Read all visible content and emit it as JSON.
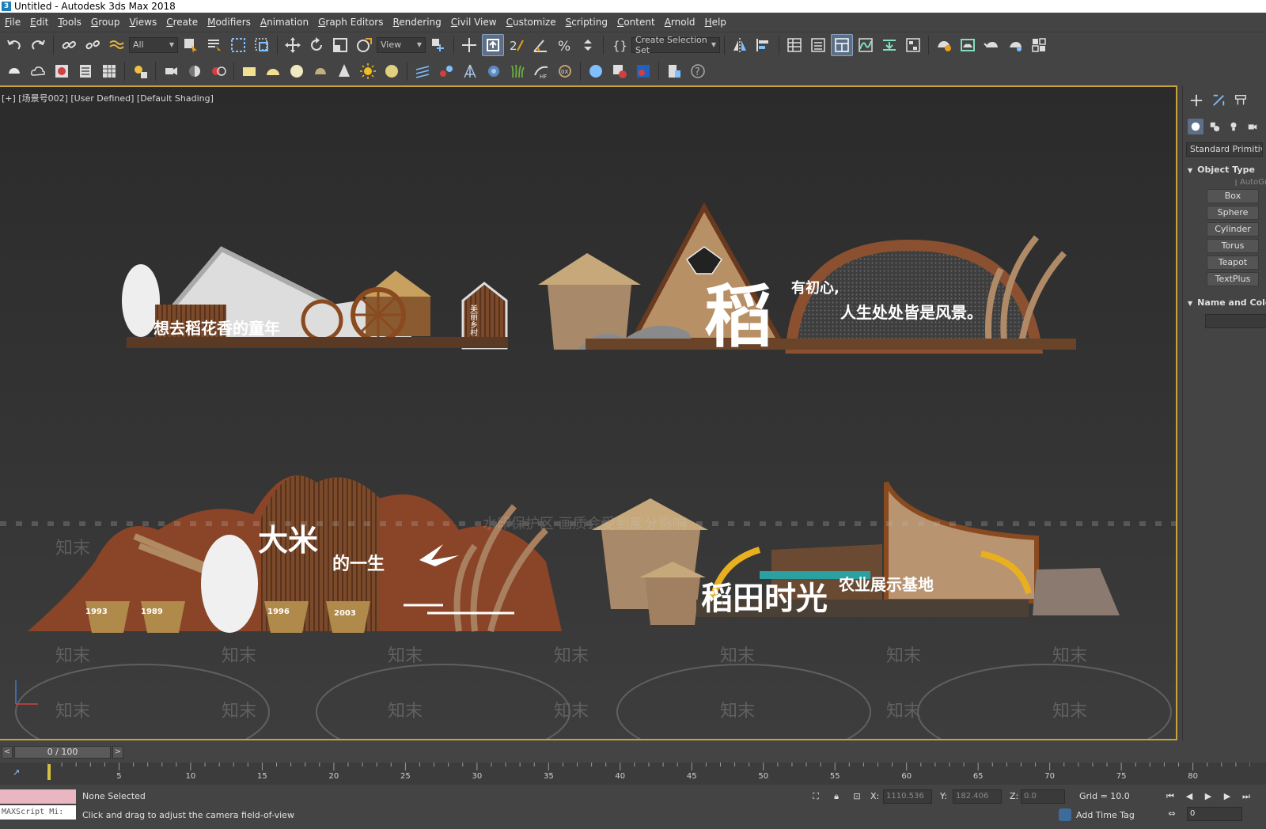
{
  "window": {
    "title": "Untitled - Autodesk 3ds Max 2018"
  },
  "menu": [
    "File",
    "Edit",
    "Tools",
    "Group",
    "Views",
    "Create",
    "Modifiers",
    "Animation",
    "Graph Editors",
    "Rendering",
    "Civil View",
    "Customize",
    "Scripting",
    "Content",
    "Arnold",
    "Help"
  ],
  "toolbar": {
    "selection_filter": "All",
    "ref_coord": "View",
    "named_selection": "Create Selection Set"
  },
  "viewport": {
    "label": "[+] [场景号002] [User Defined] [Default Shading]",
    "scene_text": {
      "sign1": "想去稻花香的童年",
      "sign1_vertical": "美丽乡村",
      "sign2_big": "稻",
      "sign2_line1": "有初心,",
      "sign2_line2": "人生处处皆是风景。",
      "sign3_title": "大米",
      "sign3_sub": "的一生",
      "sign3_years": [
        "1993",
        "1989",
        "1996",
        "2003"
      ],
      "sign4_title": "稻田时光",
      "sign4_sub": "农业展示基地"
    },
    "watermark_notice": "水印保护区  画质会受到部分影响",
    "watermark_tag": "知末"
  },
  "command_panel": {
    "category": "Standard Primitives",
    "rollout_object_type": "Object Type",
    "autogrid": "AutoGrid",
    "object_buttons": [
      "Box",
      "Sphere",
      "Cylinder",
      "Torus",
      "Teapot",
      "TextPlus"
    ],
    "rollout_name_color": "Name and Color"
  },
  "time_slider": {
    "position": "0 / 100",
    "prev": "<",
    "next": ">"
  },
  "trackbar": {
    "labels": [
      "5",
      "10",
      "15",
      "20",
      "25",
      "30",
      "35",
      "40",
      "45",
      "50",
      "55",
      "60",
      "65",
      "70",
      "75",
      "80"
    ]
  },
  "status": {
    "selection": "None Selected",
    "prompt": "Click and drag to adjust the camera field-of-view",
    "maxscript": "MAXScript Mi:",
    "x_label": "X:",
    "x_value": "1110.536",
    "y_label": "Y:",
    "y_value": "182.406",
    "z_label": "Z:",
    "z_value": "0.0",
    "grid": "Grid = 10.0",
    "add_time_tag": "Add Time Tag",
    "frame": "0"
  },
  "colors": {
    "accent_border": "#c9a23a",
    "active_button": "#5d6f86",
    "maxscript_listener": "#e9b7c2"
  }
}
